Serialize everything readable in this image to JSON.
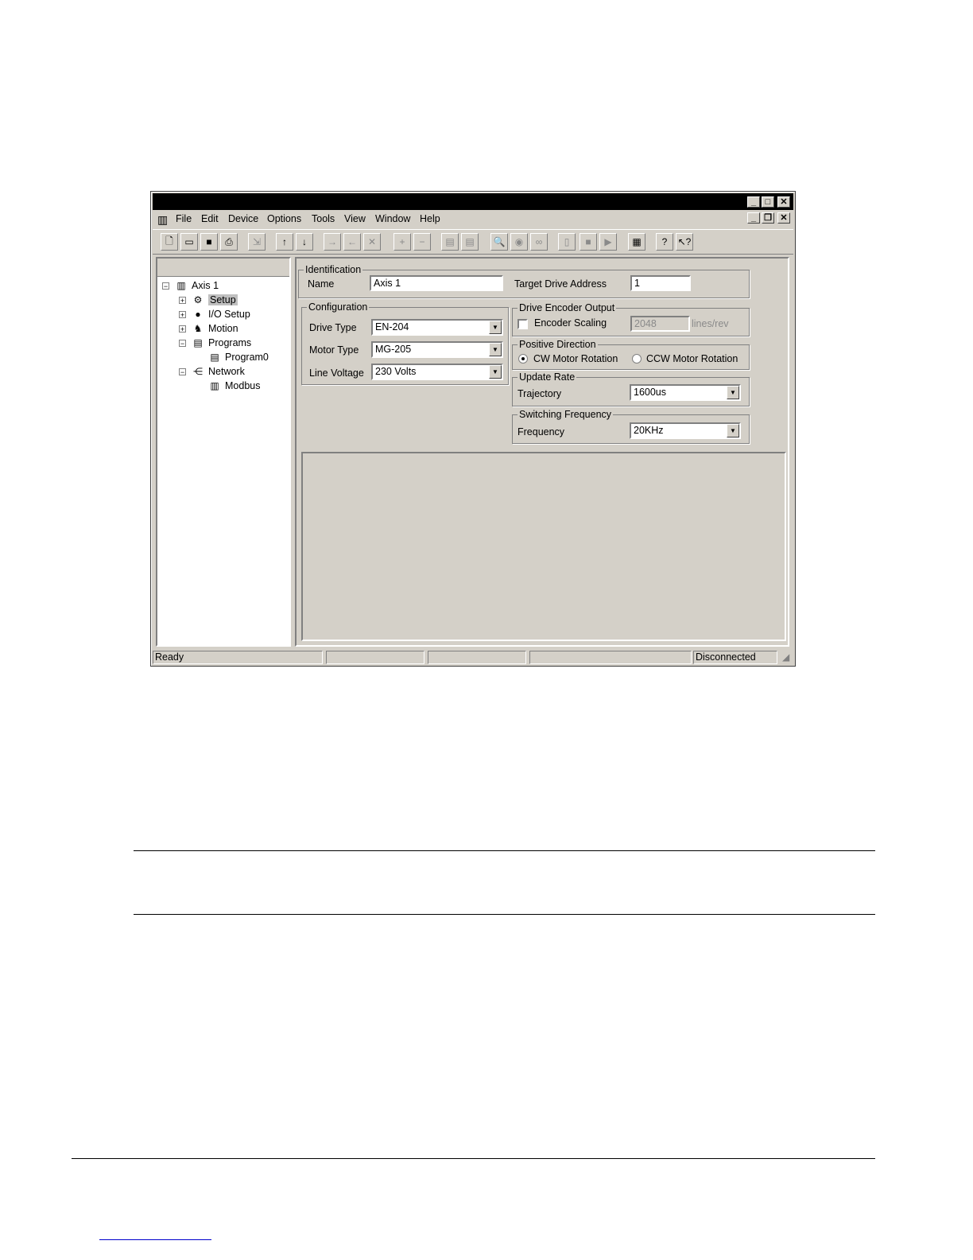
{
  "menu": [
    "File",
    "Edit",
    "Device",
    "Options",
    "Tools",
    "View",
    "Window",
    "Help"
  ],
  "toolbar_icons": [
    "new-file",
    "open-folder",
    "save",
    "print",
    "import",
    "upload",
    "download",
    "send-to",
    "receive-from",
    "cancel",
    "add-item",
    "remove-item",
    "program-a",
    "program-b",
    "zoom",
    "watch",
    "glasses",
    "drive",
    "stop",
    "run",
    "window-layout",
    "help",
    "context-help"
  ],
  "tree": {
    "root": "Axis 1",
    "items": [
      "Setup",
      "I/O Setup",
      "Motion",
      "Programs",
      "Program0",
      "Network",
      "Modbus"
    ]
  },
  "identification": {
    "legend": "Identification",
    "name_label": "Name",
    "name_value": "Axis 1",
    "address_label": "Target Drive Address",
    "address_value": "1"
  },
  "configuration": {
    "legend": "Configuration",
    "drive_type_label": "Drive Type",
    "drive_type_value": "EN-204",
    "motor_type_label": "Motor Type",
    "motor_type_value": "MG-205",
    "line_voltage_label": "Line Voltage",
    "line_voltage_value": "230 Volts"
  },
  "encoder_output": {
    "legend": "Drive Encoder Output",
    "checkbox_label": "Encoder Scaling",
    "checked": false,
    "value": "2048",
    "unit": "lines/rev"
  },
  "positive_direction": {
    "legend": "Positive Direction",
    "cw_label": "CW Motor Rotation",
    "ccw_label": "CCW Motor Rotation",
    "selected": "CW"
  },
  "update_rate": {
    "legend": "Update Rate",
    "label": "Trajectory",
    "value": "1600us"
  },
  "switching_frequency": {
    "legend": "Switching Frequency",
    "label": "Frequency",
    "value": "20KHz"
  },
  "status": {
    "left": "Ready",
    "right": "Disconnected"
  }
}
